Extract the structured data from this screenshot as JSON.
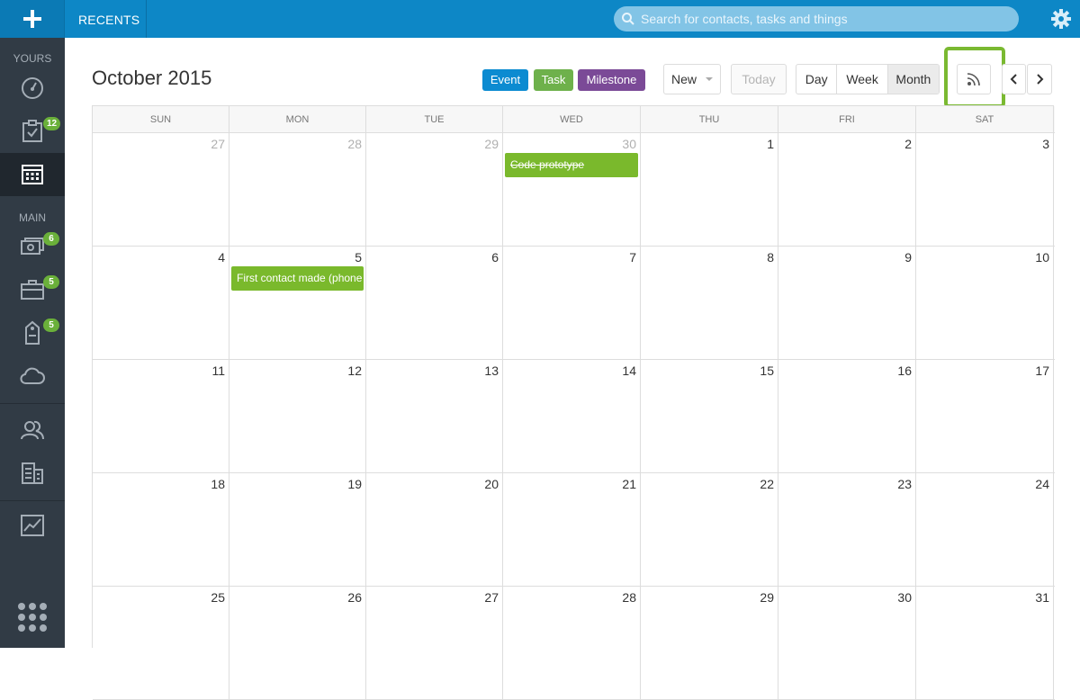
{
  "topbar": {
    "recents_label": "RECENTS",
    "search_placeholder": "Search for contacts, tasks and things"
  },
  "sidebar": {
    "yours_label": "YOURS",
    "main_label": "MAIN",
    "items": [
      {
        "name": "dashboard",
        "icon": "dashboard-gauge-icon"
      },
      {
        "name": "tasks",
        "icon": "clipboard-check-icon",
        "badge": "12"
      },
      {
        "name": "calendar",
        "icon": "calendar-icon",
        "active": true
      },
      {
        "name": "cases",
        "icon": "money-icon",
        "badge": "6"
      },
      {
        "name": "opportunities",
        "icon": "briefcase-icon",
        "badge": "5"
      },
      {
        "name": "tags",
        "icon": "tag-icon",
        "badge": "5"
      },
      {
        "name": "cloud",
        "icon": "cloud-icon"
      },
      {
        "name": "people",
        "icon": "people-icon"
      },
      {
        "name": "organisations",
        "icon": "building-icon"
      },
      {
        "name": "reports",
        "icon": "chart-icon"
      }
    ]
  },
  "calendar": {
    "title": "October 2015",
    "legend": {
      "event": "Event",
      "task": "Task",
      "milestone": "Milestone"
    },
    "buttons": {
      "new": "New",
      "today": "Today",
      "day": "Day",
      "week": "Week",
      "month": "Month"
    },
    "active_view": "Month",
    "weekdays": [
      "SUN",
      "MON",
      "TUE",
      "WED",
      "THU",
      "FRI",
      "SAT"
    ],
    "weeks": [
      [
        {
          "n": "27",
          "other": true
        },
        {
          "n": "28",
          "other": true
        },
        {
          "n": "29",
          "other": true
        },
        {
          "n": "30",
          "other": true,
          "event": "Code prototype",
          "done": true
        },
        {
          "n": "1"
        },
        {
          "n": "2"
        },
        {
          "n": "3"
        }
      ],
      [
        {
          "n": "4"
        },
        {
          "n": "5",
          "event": "First contact made (phone call)"
        },
        {
          "n": "6"
        },
        {
          "n": "7"
        },
        {
          "n": "8"
        },
        {
          "n": "9"
        },
        {
          "n": "10"
        }
      ],
      [
        {
          "n": "11"
        },
        {
          "n": "12"
        },
        {
          "n": "13"
        },
        {
          "n": "14"
        },
        {
          "n": "15"
        },
        {
          "n": "16"
        },
        {
          "n": "17"
        }
      ],
      [
        {
          "n": "18"
        },
        {
          "n": "19"
        },
        {
          "n": "20"
        },
        {
          "n": "21"
        },
        {
          "n": "22"
        },
        {
          "n": "23"
        },
        {
          "n": "24"
        }
      ],
      [
        {
          "n": "25"
        },
        {
          "n": "26"
        },
        {
          "n": "27"
        },
        {
          "n": "28"
        },
        {
          "n": "29"
        },
        {
          "n": "30"
        },
        {
          "n": "31"
        }
      ]
    ]
  },
  "colors": {
    "topbar": "#0d87c6",
    "sidebar": "#313b45",
    "event": "#0c8bd1",
    "task": "#6eb14b",
    "milestone": "#7b4a97",
    "highlight": "#7ab931"
  }
}
